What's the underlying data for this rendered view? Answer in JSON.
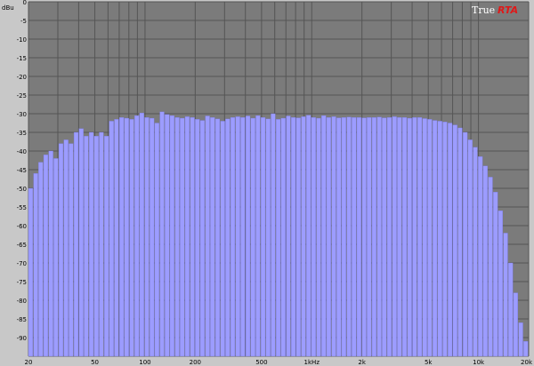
{
  "app": {
    "logo_true": "True",
    "logo_rta": "RTA"
  },
  "colors": {
    "background": "#c8c8c8",
    "plot_bg": "#7b7b7b",
    "grid": "#555555",
    "bar_fill": "#9c9cff",
    "bar_edge": "#7878e0"
  },
  "chart_data": {
    "type": "bar",
    "title": "",
    "ylabel": "dBu",
    "xlabel": "",
    "x_scale": "log",
    "xlim": [
      20,
      20000
    ],
    "ylim": [
      -95,
      0
    ],
    "grid": true,
    "y_ticks": [
      "0",
      "-5",
      "-10",
      "-15",
      "-20",
      "-25",
      "-30",
      "-35",
      "-40",
      "-45",
      "-50",
      "-55",
      "-60",
      "-65",
      "-70",
      "-75",
      "-80",
      "-85",
      "-90"
    ],
    "x_ticks": [
      {
        "value": 20,
        "label": "20"
      },
      {
        "value": 50,
        "label": "50"
      },
      {
        "value": 100,
        "label": "100"
      },
      {
        "value": 200,
        "label": "200"
      },
      {
        "value": 500,
        "label": "500"
      },
      {
        "value": 1000,
        "label": "1kHz"
      },
      {
        "value": 2000,
        "label": "2k"
      },
      {
        "value": 5000,
        "label": "5k"
      },
      {
        "value": 10000,
        "label": "10k"
      },
      {
        "value": 20000,
        "label": "20k"
      }
    ],
    "values": [
      -50,
      -46,
      -43,
      -41,
      -40,
      -42,
      -38,
      -37,
      -38,
      -35,
      -34,
      -36,
      -35,
      -36,
      -35,
      -36,
      -32,
      -31.5,
      -31,
      -31.2,
      -31.5,
      -30.5,
      -29.8,
      -31,
      -31.2,
      -32.5,
      -29.5,
      -30.2,
      -30.5,
      -31,
      -31.2,
      -30.8,
      -31,
      -31.5,
      -31.8,
      -30.6,
      -31,
      -31.4,
      -32,
      -31.4,
      -31,
      -30.8,
      -31,
      -30.6,
      -31.2,
      -30.5,
      -31,
      -31.4,
      -30,
      -31.5,
      -31.2,
      -30.6,
      -31,
      -31.1,
      -30.8,
      -30.4,
      -31,
      -31.2,
      -30.5,
      -31,
      -30.8,
      -31.1,
      -31,
      -30.9,
      -31,
      -31,
      -31.1,
      -31,
      -31,
      -30.9,
      -31.1,
      -31,
      -30.8,
      -31,
      -31,
      -31.2,
      -31,
      -31,
      -31.3,
      -31.5,
      -31.8,
      -32,
      -32.2,
      -32.5,
      -33,
      -33.8,
      -35,
      -37,
      -39,
      -41.5,
      -44,
      -47,
      -51,
      -56,
      -62,
      -70,
      -78,
      -86,
      -91
    ]
  }
}
